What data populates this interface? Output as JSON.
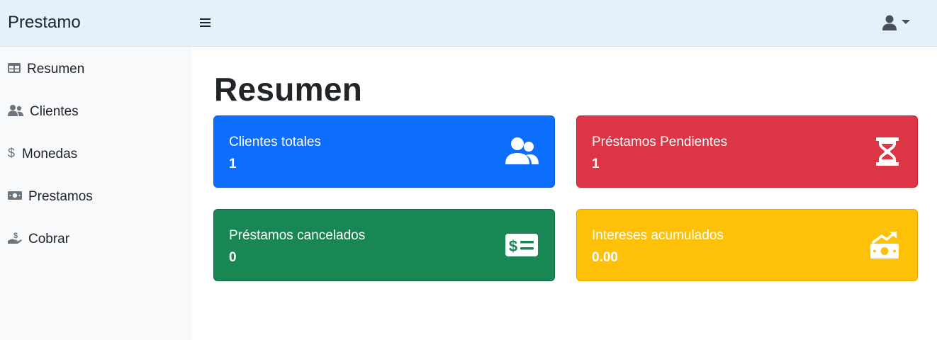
{
  "brand": "Prestamo",
  "topbar": {
    "menu_icon": "hamburger-icon",
    "user_icon": "user-icon",
    "caret_icon": "caret-down-icon"
  },
  "sidebar": {
    "items": [
      {
        "label": "Resumen",
        "icon": "table-icon"
      },
      {
        "label": "Clientes",
        "icon": "users-icon"
      },
      {
        "label": "Monedas",
        "icon": "dollar-icon"
      },
      {
        "label": "Prestamos",
        "icon": "money-bill-icon"
      },
      {
        "label": "Cobrar",
        "icon": "hand-holding-dollar-icon"
      }
    ]
  },
  "page": {
    "title": "Resumen"
  },
  "cards": [
    {
      "label": "Clientes totales",
      "value": "1",
      "icon": "users-icon",
      "color": "#0d6efd"
    },
    {
      "label": "Préstamos Pendientes",
      "value": "1",
      "icon": "hourglass-icon",
      "color": "#dc3545"
    },
    {
      "label": "Préstamos cancelados",
      "value": "0",
      "icon": "money-check-dollar-icon",
      "color": "#198754"
    },
    {
      "label": "Intereses acumulados",
      "value": "0.00",
      "icon": "money-bill-trend-up-icon",
      "color": "#ffc107"
    }
  ]
}
